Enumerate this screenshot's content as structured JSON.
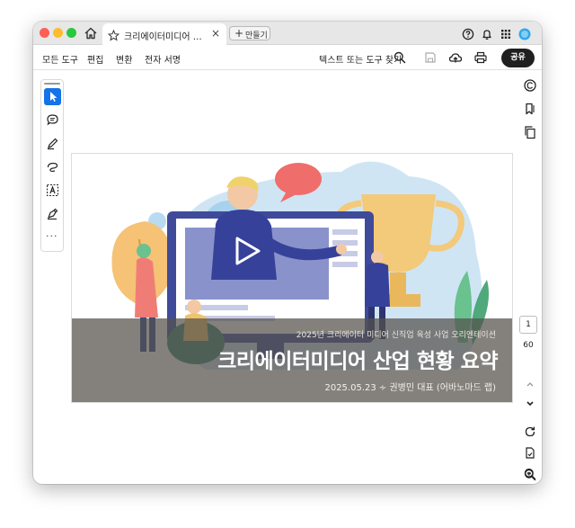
{
  "window": {
    "tab_title": "크리에이터미디어 산업 현황 요약",
    "close_glyph": "×",
    "new_tab_plus": "+",
    "new_tab_label": "만들기"
  },
  "toolbar": {
    "menu": [
      "모든 도구",
      "편집",
      "변환",
      "전자 서명"
    ],
    "search_label": "텍스트 또는 도구 찾기",
    "share_label": "공유"
  },
  "left_tools": {
    "more": "···"
  },
  "page_nav": {
    "current": "1",
    "total": "60"
  },
  "slide": {
    "subtitle": "2025년 크리에이터 미디어 신직업 육성 사업 오리엔테이션",
    "title": "크리에이터미디어 산업 현황 요약",
    "meta": "2025.05.23 ∻ 권병민 대표 (어바노마드 랩)"
  },
  "colors": {
    "accent": "#1473e6",
    "share_bg": "#1f1f1f",
    "overlay": "#55504b",
    "traffic_red": "#fe5f57",
    "traffic_yellow": "#febc2e",
    "traffic_green": "#28c840"
  }
}
